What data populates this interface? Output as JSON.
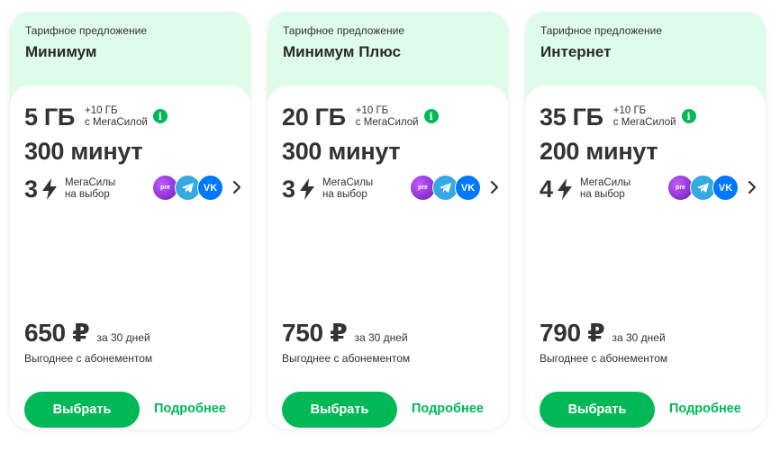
{
  "cards": [
    {
      "offer_label": "Тарифное предложение",
      "name": "Минимум",
      "data": "5 ГБ",
      "bonus_line1": "+10 ГБ",
      "bonus_line2": "с МегаСилой",
      "minutes": "300 минут",
      "power_count": "3",
      "power_line1": "МегаСилы",
      "power_line2": "на выбор",
      "price": "650 ₽",
      "period": "за 30 дней",
      "benefit": "Выгоднее с абонементом",
      "choose_label": "Выбрать",
      "more_label": "Подробнее"
    },
    {
      "offer_label": "Тарифное предложение",
      "name": "Минимум Плюс",
      "data": "20 ГБ",
      "bonus_line1": "+10 ГБ",
      "bonus_line2": "с МегаСилой",
      "minutes": "300 минут",
      "power_count": "3",
      "power_line1": "МегаСилы",
      "power_line2": "на выбор",
      "price": "750 ₽",
      "period": "за 30 дней",
      "benefit": "Выгоднее с абонементом",
      "choose_label": "Выбрать",
      "more_label": "Подробнее"
    },
    {
      "offer_label": "Тарифное предложение",
      "name": "Интернет",
      "data": "35 ГБ",
      "bonus_line1": "+10 ГБ",
      "bonus_line2": "с МегаСилой",
      "minutes": "200 минут",
      "power_count": "4",
      "power_line1": "МегаСилы",
      "power_line2": "на выбор",
      "price": "790 ₽",
      "period": "за 30 дней",
      "benefit": "Выгоднее с абонементом",
      "choose_label": "Выбрать",
      "more_label": "Подробнее"
    }
  ],
  "icons": {
    "info": "i",
    "app1": "premium",
    "app2": "telegram",
    "app3": "vk",
    "bolt": "lightning-icon",
    "chevron": "chevron-right-icon"
  },
  "colors": {
    "accent": "#00b956",
    "card_header_bg": "#dffbe9",
    "text": "#333333"
  }
}
